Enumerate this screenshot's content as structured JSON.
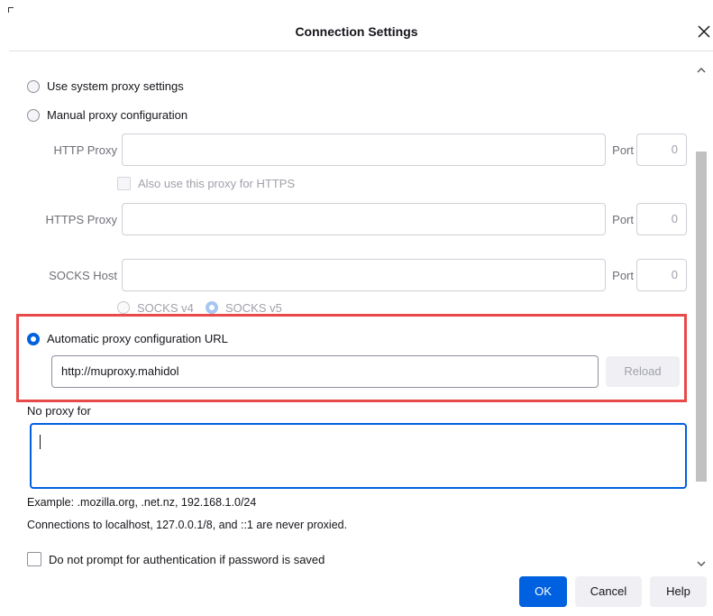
{
  "dialog": {
    "title": "Connection Settings"
  },
  "proxy_options": {
    "system": {
      "label": "Use system proxy settings",
      "checked": false
    },
    "manual": {
      "label": "Manual proxy configuration",
      "checked": false
    },
    "auto_url": {
      "label": "Automatic proxy configuration URL",
      "checked": true
    }
  },
  "manual": {
    "http_label": "HTTP Proxy",
    "http_value": "",
    "also_https_label": "Also use this proxy for HTTPS",
    "https_label": "HTTPS Proxy",
    "https_value": "",
    "socks_label": "SOCKS Host",
    "socks_value": "",
    "port_label": "Port",
    "http_port": "0",
    "https_port": "0",
    "socks_port": "0",
    "socks_v4_label": "SOCKS v4",
    "socks_v5_label": "SOCKS v5"
  },
  "auto": {
    "url_value": "http://muproxy.mahidol",
    "reload_label": "Reload"
  },
  "no_proxy": {
    "label": "No proxy for",
    "value": "",
    "example": "Example: .mozilla.org, .net.nz, 192.168.1.0/24",
    "localhost_note": "Connections to localhost, 127.0.0.1/8, and ::1 are never proxied."
  },
  "auth": {
    "label": "Do not prompt for authentication if password is saved"
  },
  "buttons": {
    "ok": "OK",
    "cancel": "Cancel",
    "help": "Help"
  },
  "colors": {
    "accent": "#0061e0",
    "highlight": "#e84a4a"
  },
  "icons": {
    "close": "close-icon",
    "scroll_up": "chevron-up-icon",
    "scroll_down": "chevron-down-icon"
  }
}
